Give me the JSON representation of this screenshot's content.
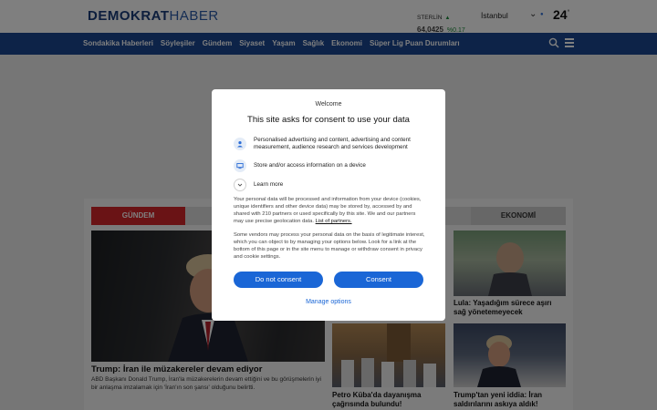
{
  "header": {
    "logo_bold": "DEMOKRAT",
    "logo_thin": "HABER",
    "ticker": {
      "name": "STERLİN",
      "value": "64,0425",
      "change": "%0.17",
      "trend_icon": "triangle-up-icon"
    },
    "city": "İstanbul",
    "temperature": "24",
    "degree": "°"
  },
  "nav": {
    "items": [
      "Sondakika Haberleri",
      "Söyleşiler",
      "Gündem",
      "Siyaset",
      "Yaşam",
      "Sağlık",
      "Ekonomi",
      "Süper Lig Puan Durumları"
    ]
  },
  "tabs": {
    "gundem": "GÜNDEM",
    "ekonomi": "EKONOMİ"
  },
  "news": {
    "main_title": "Trump: İran ile müzakereler devam ediyor",
    "main_desc": "ABD Başkanı Donald Trump, İran'la müzakerelerin devam ettiğini ve bu görüşmelerin iyi bir anlaşma imzalamak için 'İran'ın son şansı' olduğunu belirtti.",
    "lula_title": "Lula: Yaşadığım sürece aşırı sağ yönetemeyecek",
    "cuba_title": "Petro Küba'da dayanışma çağrısında bulundu!",
    "trump2_title": "Trump'tan yeni iddia: İran saldırılarını askıya aldık!"
  },
  "consent": {
    "welcome": "Welcome",
    "title": "This site asks for consent to use your data",
    "purpose1": "Personalised advertising and content, advertising and content measurement, audience research and services development",
    "purpose2": "Store and/or access information on a device",
    "learn_more": "Learn more",
    "para1": "Your personal data will be processed and information from your device (cookies, unique identifiers and other device data) may be stored by, accessed by and shared with 210 partners or used specifically by this site. We and our partners may use precise geolocation data.",
    "para1_link": "List of partners.",
    "para2": "Some vendors may process your personal data on the basis of legitimate interest, which you can object to by managing your options below. Look for a link at the bottom of this page or in the site menu to manage or withdraw consent in privacy and cookie settings.",
    "do_not_consent": "Do not consent",
    "consent": "Consent",
    "manage_options": "Manage options"
  },
  "colors": {
    "nav_bg": "#1a4690",
    "tab_active": "#d4262b",
    "button_blue": "#1a66d6",
    "logo_blue": "#1a3d7a"
  }
}
